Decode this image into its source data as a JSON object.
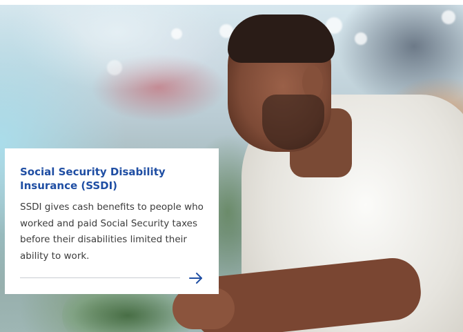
{
  "card": {
    "title": "Social Security Disability Insurance (SSDI)",
    "body": "SSDI gives cash benefits to people who worked and paid Social Security taxes before their disabilities limited their ability to work.",
    "link_icon": "arrow-right-icon"
  },
  "colors": {
    "title": "#1f4ea3",
    "arrow": "#1f4ea3",
    "body_text": "#3b3b3b",
    "card_bg": "#ffffff"
  }
}
